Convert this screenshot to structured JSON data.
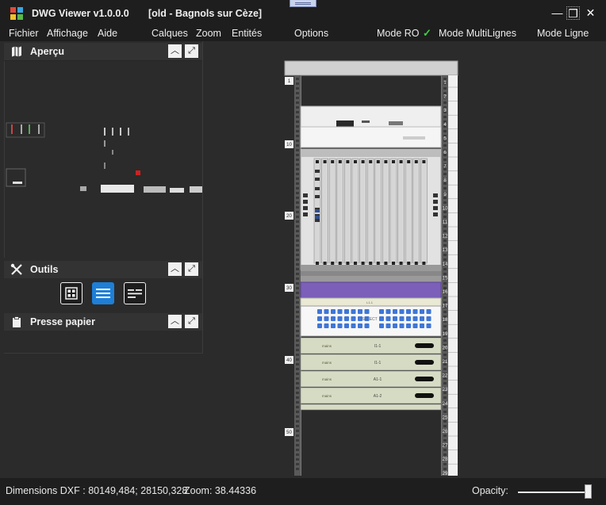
{
  "window": {
    "app_title": "DWG Viewer v1.0.0.0",
    "document_title": "[old - Bagnols sur Cèze]",
    "minimize_glyph": "—",
    "restore_glyph": "❐",
    "close_glyph": "✕"
  },
  "menu": {
    "fichier": "Fichier",
    "affichage": "Affichage",
    "aide": "Aide",
    "calques": "Calques",
    "zoom": "Zoom",
    "entites": "Entités",
    "options": "Options",
    "mode_ro": "Mode RO",
    "mode_ro_check": "✓",
    "mode_multilignes": "Mode MultiLignes",
    "mode_ligne": "Mode Ligne"
  },
  "panels": {
    "apercu": {
      "title": "Aperçu",
      "icon": "map-icon"
    },
    "outils": {
      "title": "Outils",
      "icon": "tools-icon"
    },
    "presse_papier": {
      "title": "Presse papier",
      "icon": "clipboard-icon"
    },
    "collapse_glyph": "︿",
    "expand_glyph": "⤢"
  },
  "tools": [
    {
      "name": "grid-view-icon",
      "selected": false
    },
    {
      "name": "list-view-icon",
      "selected": true
    },
    {
      "name": "split-view-icon",
      "selected": false
    }
  ],
  "rack": {
    "left_ruler_labels": [
      "1",
      "10",
      "20",
      "30",
      "40",
      "50"
    ],
    "right_ruler_labels": [
      "1",
      "2",
      "3",
      "4",
      "5",
      "6",
      "7",
      "8",
      "9",
      "10",
      "11",
      "12",
      "13",
      "14",
      "15",
      "16",
      "17",
      "18",
      "19",
      "20",
      "21",
      "22",
      "23",
      "24",
      "25",
      "26",
      "27",
      "28",
      "29"
    ],
    "panel_labels": [
      "L1-1",
      "I1-1",
      "I1-1",
      "A1-1",
      "A1-2"
    ],
    "brand_label": "mains",
    "select_label": "SELECT"
  },
  "status": {
    "dimensions": "Dimensions DXF : 80149,484; 28150,328",
    "zoom": "Zoom: 38.44336",
    "opacity_label": "Opacity:"
  },
  "opacity_value": 1.0,
  "colors": {
    "accent": "#1e7fd6",
    "background": "#2b2b2b",
    "chrome": "#1e1e1e",
    "check": "#3fcf3f",
    "rack_purple": "#7b5fb8"
  }
}
